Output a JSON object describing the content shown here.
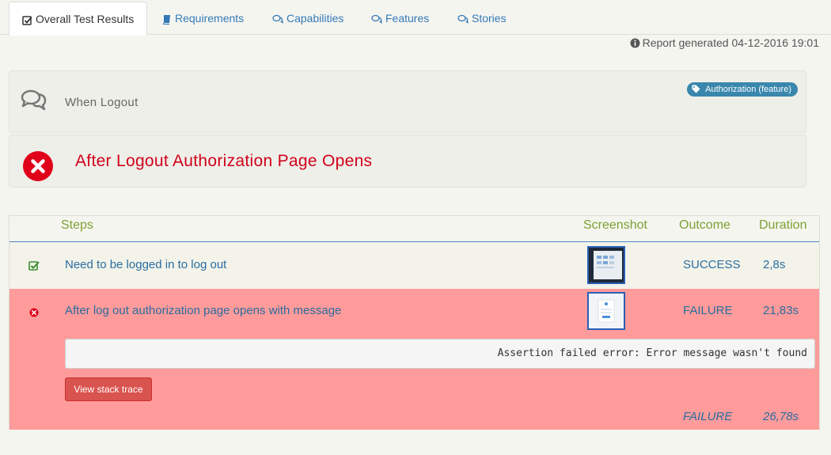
{
  "tabs": [
    {
      "label": "Overall Test Results",
      "icon": "checkbox-icon",
      "active": true
    },
    {
      "label": "Requirements",
      "icon": "book-icon"
    },
    {
      "label": "Capabilities",
      "icon": "comments-icon"
    },
    {
      "label": "Features",
      "icon": "comments-icon"
    },
    {
      "label": "Stories",
      "icon": "comments-icon"
    }
  ],
  "report_info": "Report generated 04-12-2016 19:01",
  "story": {
    "title": "When Logout",
    "tag": "Authorization (feature)"
  },
  "scenario": {
    "title": "After Logout Authorization Page Opens",
    "status": "failure"
  },
  "steps_table": {
    "headers": {
      "steps": "Steps",
      "screenshot": "Screenshot",
      "outcome": "Outcome",
      "duration": "Duration"
    },
    "rows": [
      {
        "description": "Need to be logged in to log out",
        "outcome": "SUCCESS",
        "duration": "2,8s",
        "status": "success"
      },
      {
        "description": "After log out authorization page opens with message",
        "outcome": "FAILURE",
        "duration": "21,83s",
        "status": "failure",
        "error": "Assertion failed error: Error message wasn't found",
        "button": "View stack trace"
      }
    ],
    "summary": {
      "outcome": "FAILURE",
      "duration": "26,78s"
    }
  },
  "colors": {
    "link": "#337ab7",
    "header_green": "#7da035",
    "failure_row": "#ff9b9b",
    "failure_red": "#d0021b",
    "tag_blue": "#3a87ad",
    "button_red": "#d9534f"
  }
}
